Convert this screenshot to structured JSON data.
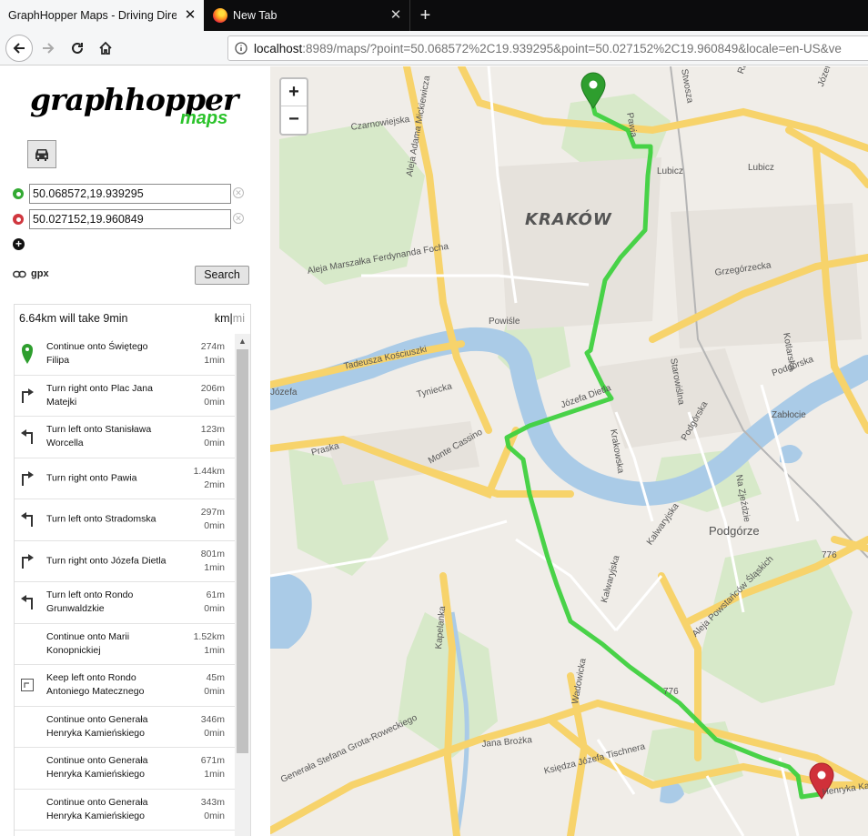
{
  "browser": {
    "tabs": [
      {
        "title": "GraphHopper Maps - Driving Direct",
        "active": true
      },
      {
        "title": "New Tab",
        "active": false
      }
    ],
    "url_host": "localhost",
    "url_rest": ":8989/maps/?point=50.068572%2C19.939295&point=50.027152%2C19.960849&locale=en-US&ve"
  },
  "app": {
    "logo_main": "graphhopper",
    "logo_sub": "maps",
    "from_value": "50.068572,19.939295",
    "to_value": "50.027152,19.960849",
    "gpx_label": "gpx",
    "search_label": "Search",
    "summary": "6.64km will take 9min",
    "units_km": "km",
    "units_sep": "|",
    "units_mi": "mi"
  },
  "instructions": [
    {
      "icon": "marker-start-icon",
      "text": "Continue onto Świętego Filipa",
      "distance": "274m",
      "time": "1min"
    },
    {
      "icon": "turn-right-icon",
      "text": "Turn right onto Plac Jana Matejki",
      "distance": "206m",
      "time": "0min"
    },
    {
      "icon": "turn-left-icon",
      "text": "Turn left onto Stanisława Worcella",
      "distance": "123m",
      "time": "0min"
    },
    {
      "icon": "turn-right-icon",
      "text": "Turn right onto Pawia",
      "distance": "1.44km",
      "time": "2min"
    },
    {
      "icon": "turn-left-icon",
      "text": "Turn left onto Stradomska",
      "distance": "297m",
      "time": "0min"
    },
    {
      "icon": "turn-right-icon",
      "text": "Turn right onto Józefa Dietla",
      "distance": "801m",
      "time": "1min"
    },
    {
      "icon": "turn-left-icon",
      "text": "Turn left onto Rondo Grunwaldzkie",
      "distance": "61m",
      "time": "0min"
    },
    {
      "icon": "continue-icon",
      "text": "Continue onto Marii Konopnickiej",
      "distance": "1.52km",
      "time": "1min"
    },
    {
      "icon": "keep-left-icon",
      "text": "Keep left onto Rondo Antoniego Matecznego",
      "distance": "45m",
      "time": "0min"
    },
    {
      "icon": "continue-icon",
      "text": "Continue onto Generała Henryka Kamieńskiego",
      "distance": "346m",
      "time": "0min"
    },
    {
      "icon": "continue-icon",
      "text": "Continue onto Generała Henryka Kamieńskiego",
      "distance": "671m",
      "time": "1min"
    },
    {
      "icon": "continue-icon",
      "text": "Continue onto Generała Henryka Kamieńskiego",
      "distance": "343m",
      "time": "0min"
    }
  ],
  "map": {
    "zoom_in": "+",
    "zoom_out": "−",
    "city": "KRAKÓW",
    "district": "Podgórze",
    "labels": [
      "Czarnowiejska",
      "Aleja Adama Mickiewicza",
      "Lubicz",
      "Lubicz",
      "Grzegórzecka",
      "Aleja Marszałka Ferdynanda Focha",
      "Powiśle",
      "Tadeusza Kościuszki",
      "Tyniecka",
      "Józefa",
      "Praska",
      "Monte Cassino",
      "Józefa Dietla",
      "Krakowska",
      "Podgórska",
      "Starowiślna",
      "Kotlarska",
      "Podgórska",
      "Zabłocie",
      "Na Zjeździe",
      "Kalwaryjska",
      "Kalwaryjska",
      "Kapelanka",
      "Wadowicka",
      "Jana Brożka",
      "Księdza Józefa Tischnera",
      "Generała Stefana Grota-Roweckiego",
      "Aleja Powstańców Śląskich",
      "776",
      "776",
      "Pawia",
      "Stwosza",
      "Rakowicka",
      "Józefa Brodo",
      "Henryka Kam"
    ],
    "route_color": "#3fd13f",
    "start_marker_color": "#2e9e2e",
    "end_marker_color": "#d0303a"
  }
}
